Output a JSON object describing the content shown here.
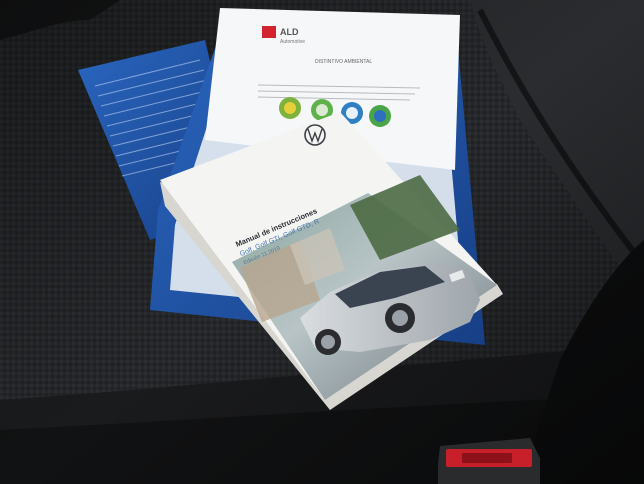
{
  "folder": {
    "brand": "ALD",
    "brand_sub": "Automotive",
    "sticker_title": "DISTINTIVO AMBIENTAL"
  },
  "manual": {
    "title": "Manual de instrucciones",
    "models": "Golf, Golf GTI, Golf GTD, R",
    "edition": "Edición 11.2019"
  },
  "colors": {
    "seat_dark": "#1d1e20",
    "seat_mid": "#2e3033",
    "folder_blue": "#1f56a8",
    "manual_white": "#f2f2f0",
    "buckle_red": "#c8202a",
    "ald_red": "#d3232e"
  },
  "icons": [
    "vw-logo-icon",
    "ald-logo-icon",
    "eco-badge-icon",
    "seatbelt-buckle-icon"
  ]
}
